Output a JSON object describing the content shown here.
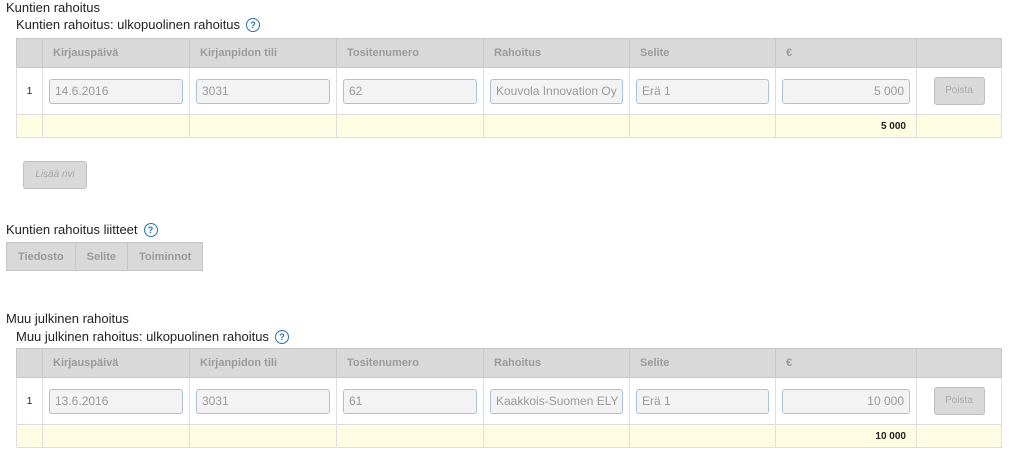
{
  "section1": {
    "title": "Kuntien rahoitus",
    "subtitle": "Kuntien rahoitus: ulkopuolinen rahoitus",
    "help_icon": "?",
    "columns": [
      "",
      "Kirjauspäivä",
      "Kirjanpidon tili",
      "Tositenumero",
      "Rahoitus",
      "Selite",
      "€",
      ""
    ],
    "rows": [
      {
        "num": "1",
        "date": "14.6.2016",
        "account": "3031",
        "voucher": "62",
        "funding": "Kouvola Innovation Oy",
        "desc": "Erä 1",
        "amount": "5 000",
        "delete": "Poista"
      }
    ],
    "total": "5 000",
    "add_row": "Lisää rivi"
  },
  "attachments": {
    "title": "Kuntien rahoitus liitteet",
    "help_icon": "?",
    "columns": [
      "Tiedosto",
      "Selite",
      "Toiminnot"
    ]
  },
  "section2": {
    "title": "Muu julkinen rahoitus",
    "subtitle": "Muu julkinen rahoitus: ulkopuolinen rahoitus",
    "help_icon": "?",
    "columns": [
      "",
      "Kirjauspäivä",
      "Kirjanpidon tili",
      "Tositenumero",
      "Rahoitus",
      "Selite",
      "€",
      ""
    ],
    "rows": [
      {
        "num": "1",
        "date": "13.6.2016",
        "account": "3031",
        "voucher": "61",
        "funding": "Kaakkois-Suomen ELY",
        "desc": "Erä 1",
        "amount": "10 000",
        "delete": "Poista"
      }
    ],
    "total": "10 000"
  }
}
